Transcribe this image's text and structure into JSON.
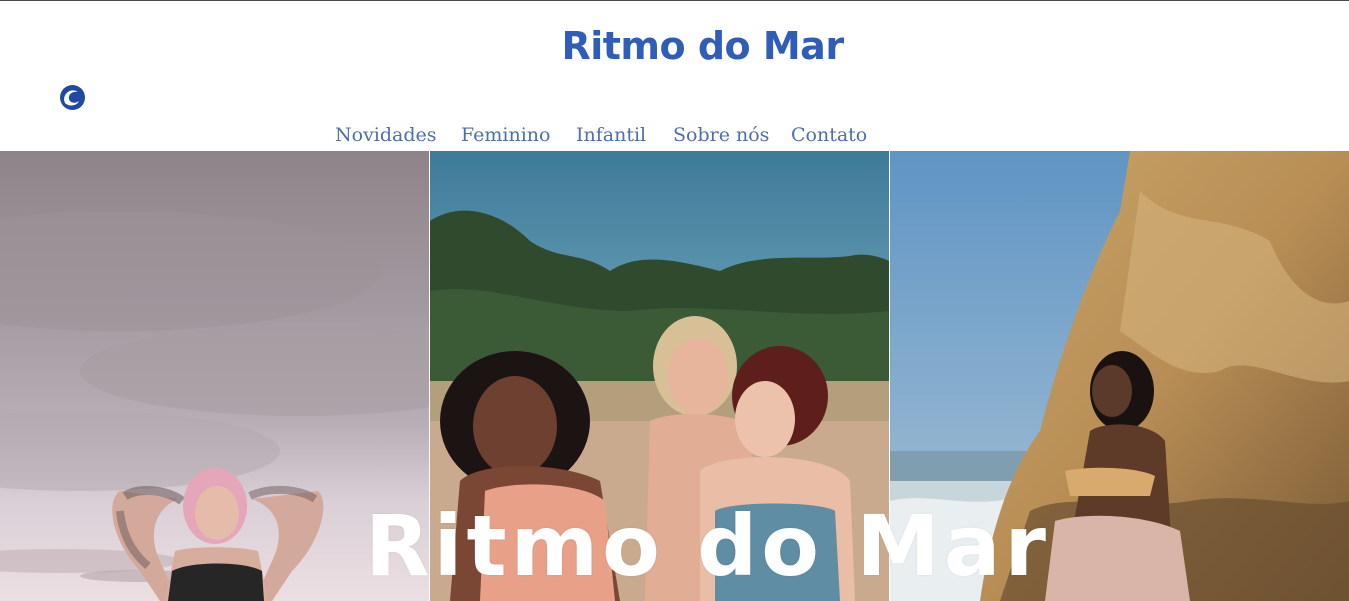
{
  "header": {
    "title": "Ritmo do Mar",
    "logo_icon": "wave-icon"
  },
  "nav": {
    "items": [
      {
        "label": "Novidades"
      },
      {
        "label": "Feminino"
      },
      {
        "label": "Infantil"
      },
      {
        "label": "Sobre nós"
      },
      {
        "label": "Contato"
      }
    ]
  },
  "hero": {
    "title": "Ritmo do Mar",
    "images": [
      {
        "description_icon": "photo-woman-tattoos-sky"
      },
      {
        "description_icon": "photo-three-women-laughing-beach"
      },
      {
        "description_icon": "photo-woman-rocks-beach"
      }
    ]
  },
  "colors": {
    "brand": "#2f5db8",
    "nav_text": "#4f6fa8",
    "hero_title": "#ffffff"
  }
}
